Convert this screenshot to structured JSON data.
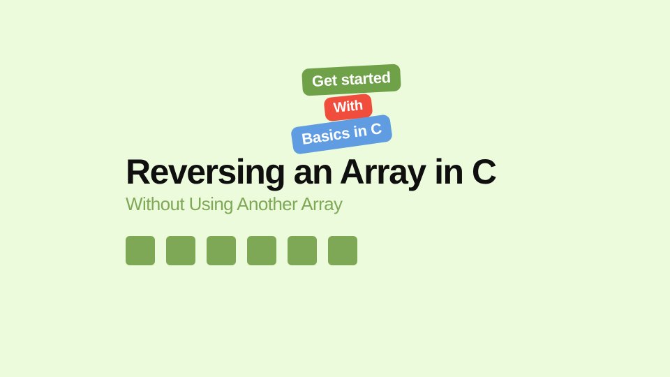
{
  "tags": {
    "green": "Get started",
    "red": "With",
    "blue": "Basics in C"
  },
  "title": "Reversing an Array in C",
  "subtitle": "Without Using Another Array",
  "box_count": 6,
  "colors": {
    "background": "#ecfbdb",
    "title": "#0f0f0f",
    "subtitle": "#7fa857",
    "box": "#7ea855",
    "tag_green": "#6fa148",
    "tag_red": "#f04d3d",
    "tag_blue": "#5f9ce1"
  }
}
